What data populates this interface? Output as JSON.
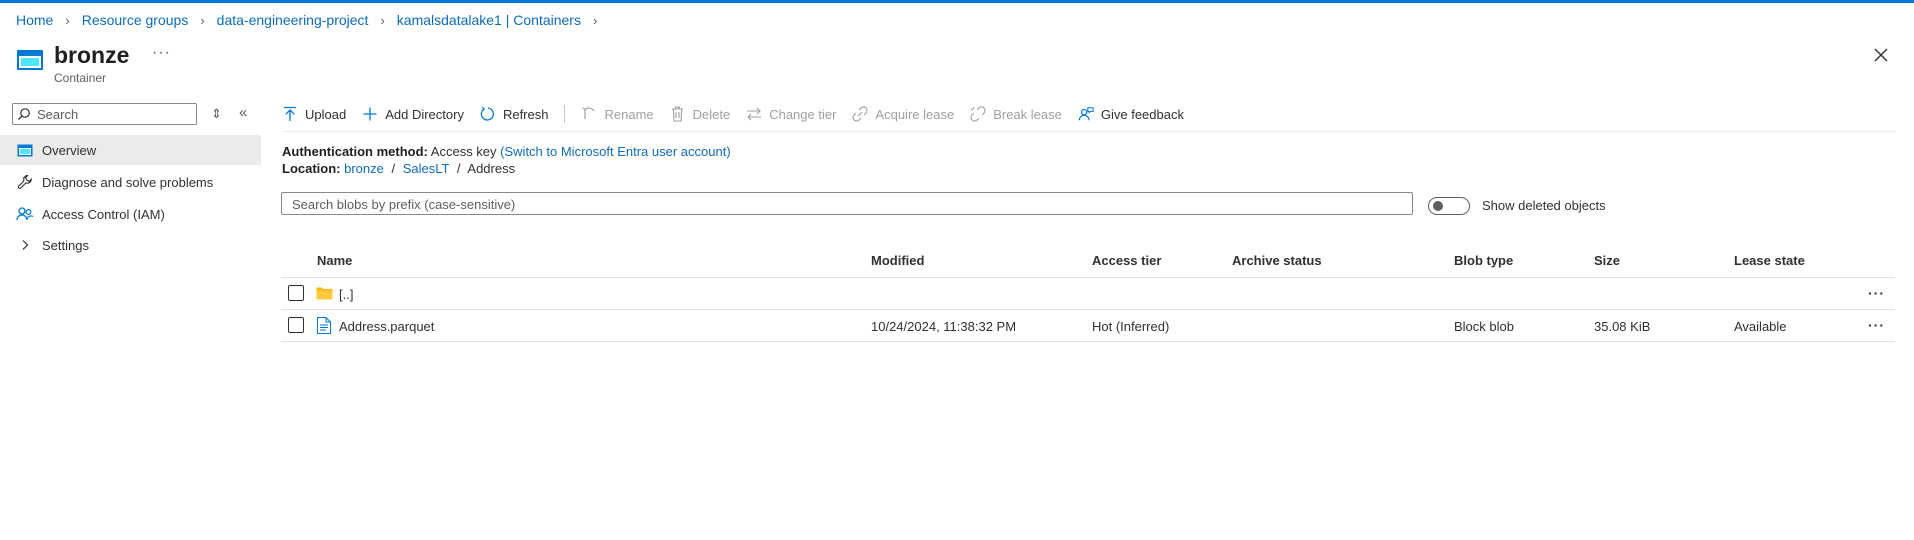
{
  "breadcrumb": {
    "items": [
      "Home",
      "Resource groups",
      "data-engineering-project",
      "kamalsdatalake1 | Containers"
    ]
  },
  "header": {
    "title": "bronze",
    "subtitle": "Container",
    "more": "···"
  },
  "sidebar": {
    "search_placeholder": "Search",
    "items": [
      {
        "label": "Overview",
        "icon": "container-icon",
        "selected": true
      },
      {
        "label": "Diagnose and solve problems",
        "icon": "wrench-icon",
        "selected": false
      },
      {
        "label": "Access Control (IAM)",
        "icon": "people-icon",
        "selected": false
      },
      {
        "label": "Settings",
        "icon": "chevron-right-icon",
        "selected": false
      }
    ]
  },
  "toolbar": {
    "upload": "Upload",
    "add_directory": "Add Directory",
    "refresh": "Refresh",
    "rename": "Rename",
    "delete": "Delete",
    "change_tier": "Change tier",
    "acquire_lease": "Acquire lease",
    "break_lease": "Break lease",
    "give_feedback": "Give feedback"
  },
  "info": {
    "auth_label": "Authentication method:",
    "auth_value": "Access key",
    "auth_link": "(Switch to Microsoft Entra user account)",
    "location_label": "Location:",
    "location_parts": [
      "bronze",
      "SalesLT",
      "Address"
    ],
    "location_sep": "/"
  },
  "blob_search": {
    "placeholder": "Search blobs by prefix (case-sensitive)"
  },
  "show_deleted": {
    "label": "Show deleted objects",
    "on": false
  },
  "table": {
    "columns": [
      "Name",
      "Modified",
      "Access tier",
      "Archive status",
      "Blob type",
      "Size",
      "Lease state"
    ],
    "rows": [
      {
        "name": "[..]",
        "type": "folder",
        "modified": "",
        "access_tier": "",
        "archive_status": "",
        "blob_type": "",
        "size": "",
        "lease_state": ""
      },
      {
        "name": "Address.parquet",
        "type": "file",
        "modified": "10/24/2024, 11:38:32 PM",
        "access_tier": "Hot (Inferred)",
        "archive_status": "",
        "blob_type": "Block blob",
        "size": "35.08 KiB",
        "lease_state": "Available"
      }
    ],
    "row_more": "···"
  },
  "colors": {
    "accent": "#0078d4",
    "link": "#0f6cbd",
    "folder": "#ffb900",
    "selected_bg": "#edebe9"
  }
}
